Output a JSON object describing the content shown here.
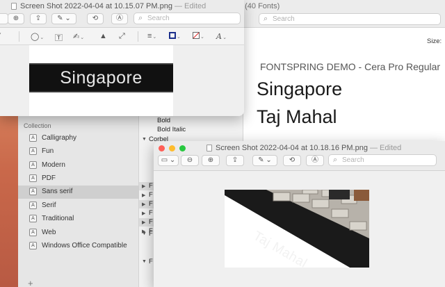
{
  "font_book": {
    "title_fragment": "f (40 Fonts)",
    "search_placeholder": "Search",
    "search_icon": "magnifier-icon",
    "section_label": "Collection",
    "collections": [
      {
        "label": "Calligraphy",
        "selected": false
      },
      {
        "label": "Fun",
        "selected": false
      },
      {
        "label": "Modern",
        "selected": false
      },
      {
        "label": "PDF",
        "selected": false
      },
      {
        "label": "Sans serif",
        "selected": true
      },
      {
        "label": "Serif",
        "selected": false
      },
      {
        "label": "Traditional",
        "selected": false
      },
      {
        "label": "Web",
        "selected": false
      },
      {
        "label": "Windows Office Compatible",
        "selected": false
      }
    ],
    "font_list": {
      "styles": [
        "Bold",
        "Bold Italic"
      ],
      "family": "Corbel",
      "collapsed_rows": [
        "F",
        "F",
        "F",
        "F",
        "F",
        "F"
      ],
      "expanded_rows": [
        "F",
        "F"
      ]
    },
    "preview": {
      "size_label": "Size:",
      "demo_name": "FONTSPRING DEMO - Cera Pro Regular",
      "sample_1": "Singapore",
      "sample_2": "Taj Mahal"
    }
  },
  "preview_window_1": {
    "title": "Screen Shot 2022-04-04 at 10.15.07 PM.png",
    "edited_label": "— Edited",
    "search_placeholder": "Search",
    "image_text": "Singapore",
    "toolbar_icons": [
      "zoom-in-icon",
      "share-icon",
      "markup-pen-icon",
      "rotate-icon",
      "annotate-icon"
    ],
    "markup_icons": [
      "sketch-icon",
      "shapes-icon",
      "text-box-icon",
      "sign-icon",
      "adjust-color-icon",
      "resize-icon",
      "line-style-icon",
      "border-color-icon",
      "fill-color-icon",
      "font-style-icon"
    ]
  },
  "preview_window_2": {
    "title": "Screen Shot 2022-04-04 at 10.18.16 PM.png",
    "edited_label": "— Edited",
    "search_placeholder": "Search",
    "image_text": "Taj Mahal",
    "toolbar_icons": [
      "sidebar-icon",
      "zoom-out-icon",
      "zoom-in-icon",
      "share-icon",
      "markup-pen-icon",
      "rotate-icon",
      "annotate-icon"
    ],
    "colors": {
      "close": "#ff5f57",
      "minimize": "#febc2e",
      "zoom": "#28c840"
    }
  }
}
